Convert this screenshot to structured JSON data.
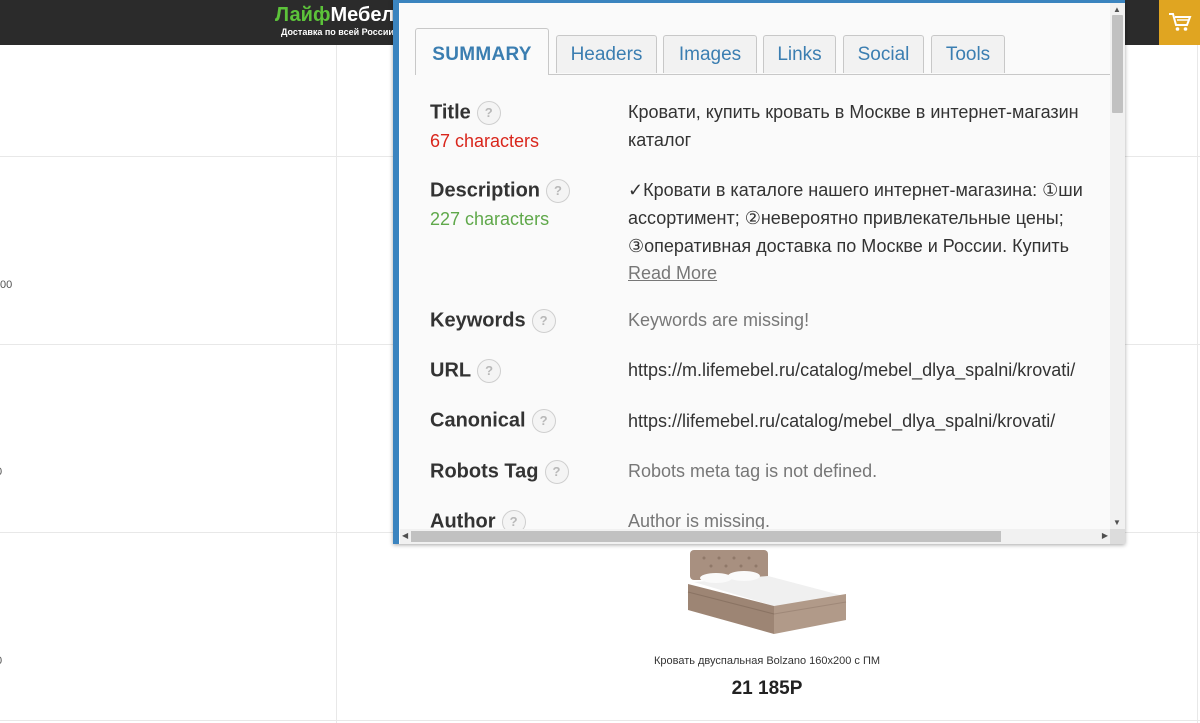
{
  "site": {
    "logo_part1": "Лайф",
    "logo_part2": "Мебель",
    "tagline": "Доставка по всей России",
    "edge_chars": [
      "00",
      "0",
      "0"
    ],
    "product": {
      "name": "Кровать двуспальная Bolzano 160х200 с ПМ",
      "price": "21 185Р"
    }
  },
  "popup": {
    "tabs": [
      {
        "label": "SUMMARY",
        "active": true
      },
      {
        "label": "Headers"
      },
      {
        "label": "Images"
      },
      {
        "label": "Links"
      },
      {
        "label": "Social"
      },
      {
        "label": "Tools"
      }
    ],
    "help_glyph": "?",
    "rows": {
      "title": {
        "label": "Title",
        "count": "67 characters",
        "value_lines": [
          "Кровати, купить кровать в Москве в интернет-магазин",
          "каталог"
        ]
      },
      "description": {
        "label": "Description",
        "count": "227 characters",
        "value_lines": [
          "✓Кровати в каталоге нашего интернет-магазина: ①ши",
          "ассортимент; ②невероятно привлекательные цены;",
          "③оперативная доставка по Москве и России. Купить"
        ],
        "read_more": "Read More"
      },
      "keywords": {
        "label": "Keywords",
        "value": "Keywords are missing!"
      },
      "url": {
        "label": "URL",
        "value": "https://m.lifemebel.ru/catalog/mebel_dlya_spalni/krovati/"
      },
      "canonical": {
        "label": "Canonical",
        "value": "https://lifemebel.ru/catalog/mebel_dlya_spalni/krovati/"
      },
      "robots": {
        "label": "Robots Tag",
        "value": "Robots meta tag is not defined."
      },
      "author": {
        "label": "Author",
        "value": "Author is missing."
      }
    }
  },
  "colors": {
    "accent_blue": "#3b84bf",
    "tab_text": "#3b7eb1",
    "count_red": "#d9261c",
    "count_green": "#5fa84a",
    "logo_green": "#5cc33a",
    "cart_bg": "#e0a521",
    "header_bg": "#2b2b2b"
  },
  "icons": {
    "cart": "cart-icon",
    "help": "help-circle-icon",
    "scroll_up": "scroll-up-icon",
    "scroll_down": "scroll-down-icon",
    "scroll_left": "scroll-left-icon",
    "scroll_right": "scroll-right-icon"
  }
}
